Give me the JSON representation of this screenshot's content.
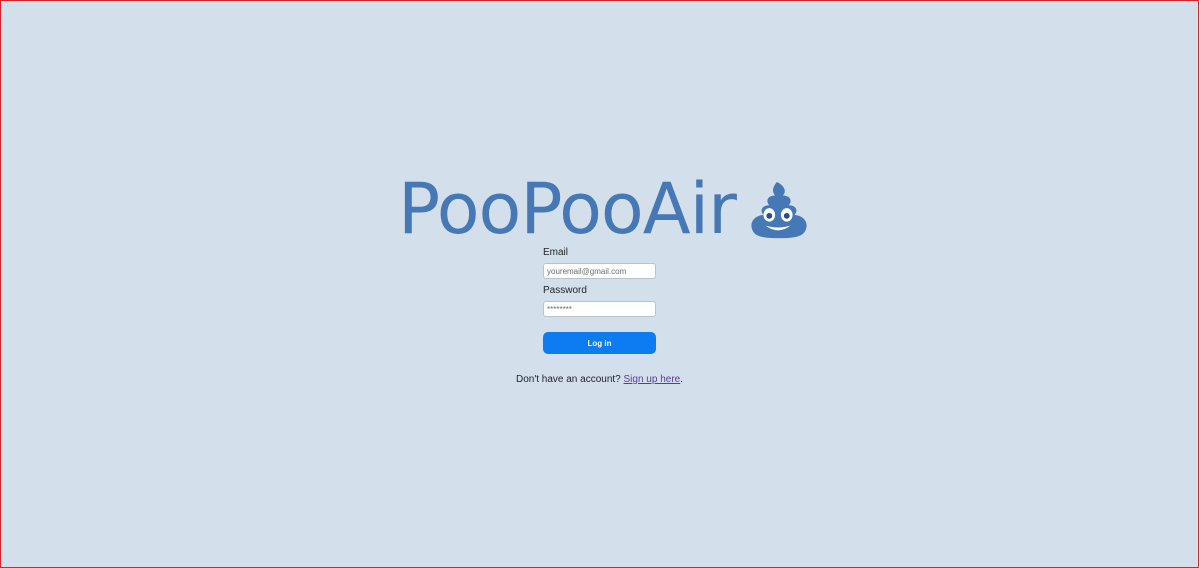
{
  "brand": {
    "title": "PooPooAir",
    "icon": "pile-of-poo-icon",
    "color": "#4578b4"
  },
  "form": {
    "email_label": "Email",
    "email_placeholder": "youremail@gmail.com",
    "password_label": "Password",
    "password_placeholder": "********",
    "login_label": "Log in",
    "button_color": "#0d7cf2"
  },
  "signup": {
    "prompt": "Don't have an account? ",
    "link_text": "Sign up here",
    "suffix": "."
  },
  "page": {
    "background": "#d3dfea"
  }
}
